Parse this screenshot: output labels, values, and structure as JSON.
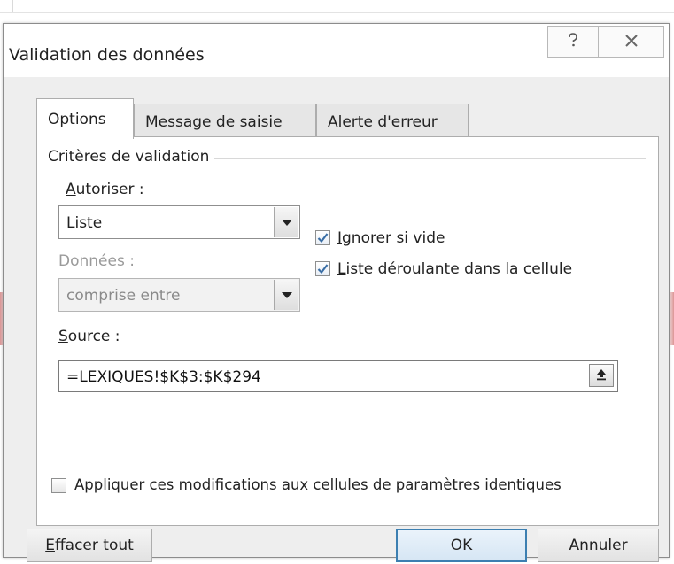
{
  "window": {
    "title": "Validation des données",
    "help_icon": "help-icon",
    "close_icon": "close-icon"
  },
  "tabs": [
    {
      "label": "Options",
      "active": true
    },
    {
      "label": "Message de saisie",
      "active": false
    },
    {
      "label": "Alerte d'erreur",
      "active": false
    }
  ],
  "criteria": {
    "group_label": "Critères de validation",
    "allow_label_underlined": "A",
    "allow_label_rest": "utoriser :",
    "allow_value": "Liste",
    "data_label": "Données :",
    "data_value": "comprise entre",
    "ignore_blank_underlined": "I",
    "ignore_blank_rest": "gnorer si vide",
    "ignore_blank_checked": true,
    "dropdown_underlined": "L",
    "dropdown_rest": "iste déroulante dans la cellule",
    "dropdown_checked": true,
    "source_label_underlined": "S",
    "source_label_rest": "ource :",
    "source_value": "=LEXIQUES!$K$3:$K$294"
  },
  "apply": {
    "label_before": "Appliquer ces modifi",
    "label_underlined": "c",
    "label_after": "ations aux cellules de paramètres identiques",
    "checked": false
  },
  "buttons": {
    "clear_underlined": "E",
    "clear_rest": "ffacer tout",
    "ok": "OK",
    "cancel": "Annuler"
  },
  "colors": {
    "check_mark": "#3a6ea5",
    "default_button_border": "#3c7fb1"
  }
}
